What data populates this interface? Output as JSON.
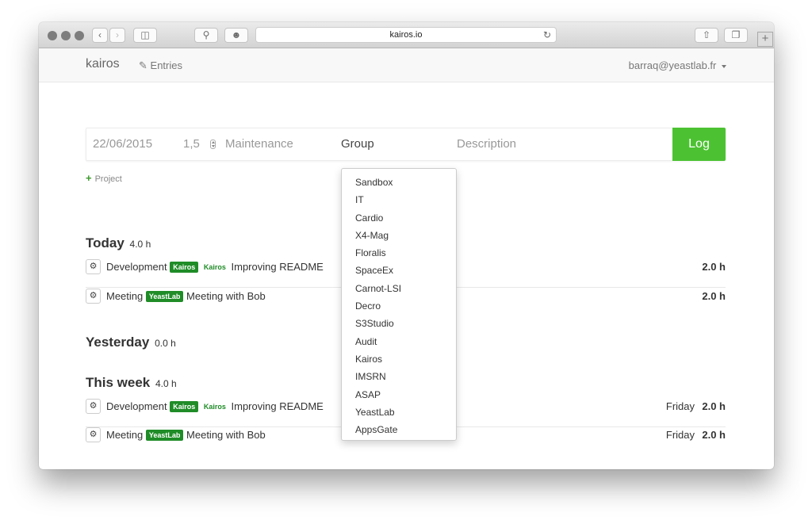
{
  "browser": {
    "url": "kairos.io"
  },
  "nav": {
    "brand": "kairos",
    "entries_label": "Entries",
    "user_email": "barraq@yeastlab.fr"
  },
  "form": {
    "date_value": "22/06/2015",
    "duration_value": "1,5",
    "activity_value": "Maintenance",
    "group_value": "Group",
    "description_placeholder": "Description",
    "log_label": "Log",
    "project_link": "Project"
  },
  "group_options": [
    "Sandbox",
    "IT",
    "Cardio",
    "X4-Mag",
    "Floralis",
    "SpaceEx",
    "Carnot-LSI",
    "Decro",
    "S3Studio",
    "Audit",
    "Kairos",
    "IMSRN",
    "ASAP",
    "YeastLab",
    "AppsGate"
  ],
  "sections": {
    "today": {
      "title": "Today",
      "hours": "4.0 h",
      "entries": [
        {
          "activity": "Development",
          "badge": "Kairos",
          "group": "Kairos",
          "description": "Improving README",
          "day": "",
          "hours": "2.0 h"
        },
        {
          "activity": "Meeting",
          "badge": "YeastLab",
          "group": "",
          "description": "Meeting with Bob",
          "day": "",
          "hours": "2.0 h"
        }
      ]
    },
    "yesterday": {
      "title": "Yesterday",
      "hours": "0.0 h"
    },
    "week": {
      "title": "This week",
      "hours": "4.0 h",
      "entries": [
        {
          "activity": "Development",
          "badge": "Kairos",
          "group": "Kairos",
          "description": "Improving README",
          "day": "Friday",
          "hours": "2.0 h"
        },
        {
          "activity": "Meeting",
          "badge": "YeastLab",
          "group": "",
          "description": "Meeting with Bob",
          "day": "Friday",
          "hours": "2.0 h"
        }
      ]
    }
  },
  "colors": {
    "accent_green": "#4cc232",
    "badge_green": "#1f8c27"
  }
}
